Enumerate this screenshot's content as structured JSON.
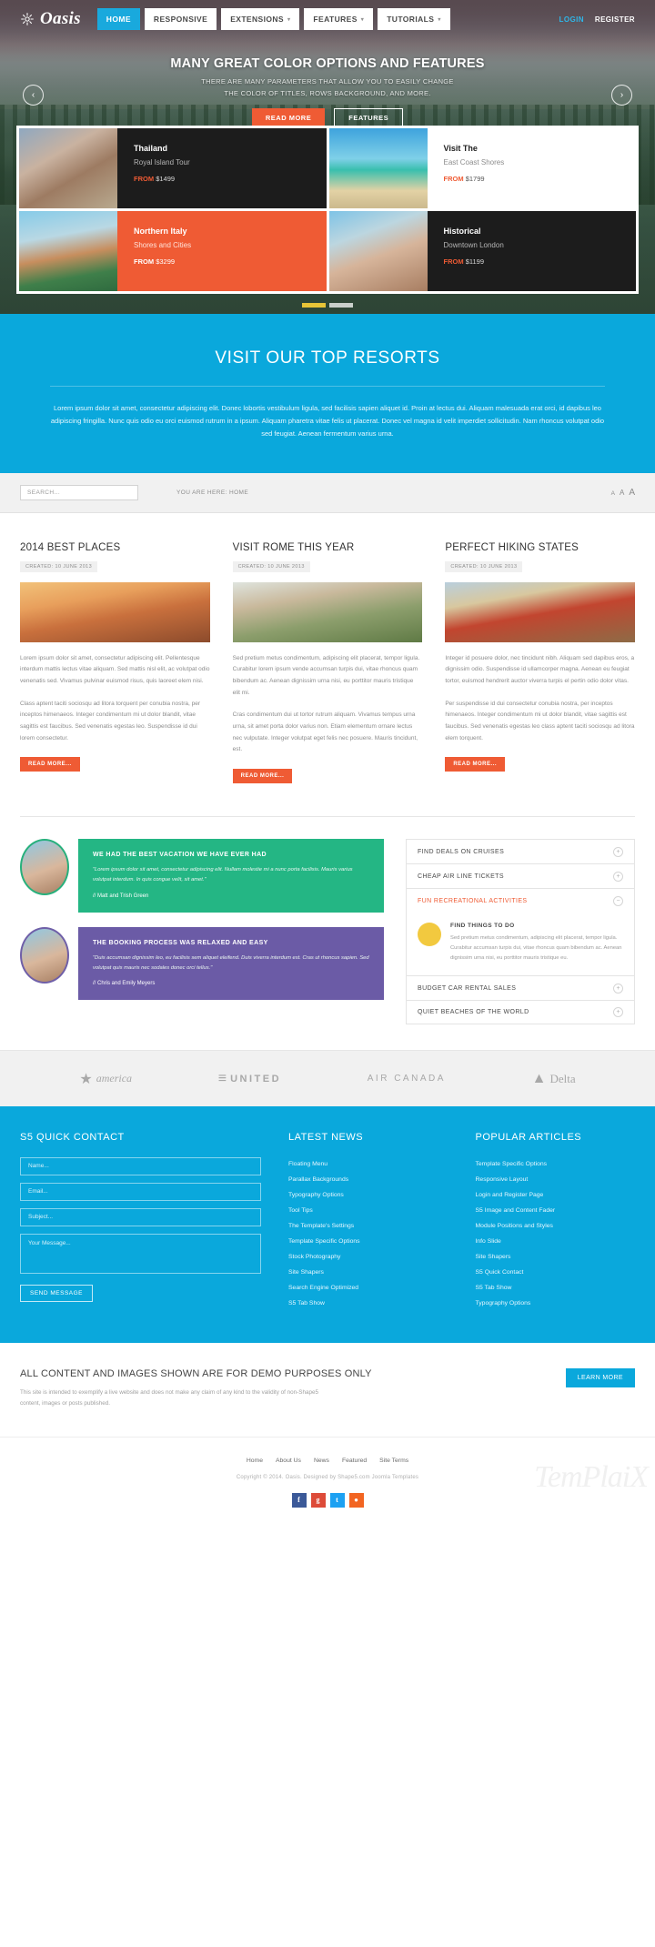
{
  "header": {
    "logo_text": "Oasis",
    "logo_icon": "gear-icon",
    "nav": [
      {
        "label": "HOME",
        "has_caret": false
      },
      {
        "label": "RESPONSIVE",
        "has_caret": false
      },
      {
        "label": "EXTENSIONS",
        "has_caret": true
      },
      {
        "label": "FEATURES",
        "has_caret": true
      },
      {
        "label": "TUTORIALS",
        "has_caret": true
      }
    ],
    "login": "LOGIN",
    "register": "REGISTER"
  },
  "hero": {
    "title": "MANY GREAT COLOR OPTIONS AND FEATURES",
    "sub1": "THERE ARE MANY PARAMETERS THAT ALLOW YOU TO EASILY CHANGE",
    "sub2": "THE COLOR OF TITLES, ROWS BACKGROUND, AND MORE.",
    "btn_primary": "READ MORE",
    "btn_secondary": "FEATURES",
    "arrow_prev": "‹",
    "arrow_next": "›"
  },
  "cards": [
    {
      "title": "Thailand",
      "sub": "Royal Island Tour",
      "from": "FROM",
      "price": "$1499",
      "style": "dark",
      "img": "img-bike"
    },
    {
      "title": "Visit The",
      "sub": "East Coast Shores",
      "from": "FROM",
      "price": "$1799",
      "style": "light",
      "img": "img-beach"
    },
    {
      "title": "Northern Italy",
      "sub": "Shores and Cities",
      "from": "FROM",
      "price": "$3299",
      "style": "orange",
      "img": "img-italy"
    },
    {
      "title": "Historical",
      "sub": "Downtown London",
      "from": "FROM",
      "price": "$1199",
      "style": "dark",
      "img": "img-couple"
    }
  ],
  "resorts": {
    "title": "VISIT OUR TOP RESORTS",
    "body": "Lorem ipsum dolor sit amet, consectetur adipiscing elit. Donec lobortis vestibulum ligula, sed facilisis sapien aliquet id. Proin at lectus dui. Aliquam malesuada erat orci, id dapibus leo adipiscing fringilla. Nunc quis odio eu orci euismod rutrum in a ipsum. Aliquam pharetra vitae felis ut placerat. Donec vel magna id velit imperdiet sollicitudin. Nam rhoncus volutpat odio sed feugiat. Aenean fermentum varius urna."
  },
  "searchbar": {
    "placeholder": "SEARCH...",
    "breadcrumb": "YOU ARE HERE:  HOME",
    "font_small": "A",
    "font_medium": "A",
    "font_large": "A"
  },
  "articles": [
    {
      "title": "2014 BEST PLACES",
      "meta": "CREATED: 10 JUNE 2013",
      "img": "ai1",
      "p1": "Lorem ipsum dolor sit amet, consectetur adipiscing elit. Pellentesque interdum mattis lectus vitae aliquam. Sed mattis nisl elit, ac volutpat odio venenatis sed. Vivamus pulvinar euismod risus, quis laoreet elem nisi.",
      "p2": "Class aptent taciti sociosqu ad litora torquent per conubia nostra, per inceptos himenaeos. Integer condimentum mi ut dolor blandit, vitae sagittis est faucibus. Sed venenatis egestas leo. Suspendisse id dui lorem consectetur.",
      "btn": "READ MORE..."
    },
    {
      "title": "VISIT ROME THIS YEAR",
      "meta": "CREATED: 10 JUNE 2013",
      "img": "ai2",
      "p1": "Sed pretium metus condimentum, adipiscing elit placerat, tempor ligula. Curabitur lorem ipsum vende accumsan turpis dui, vitae rhoncus quam bibendum ac. Aenean dignissim urna nisi, eu porttitor mauris tristique elit mi.",
      "p2": "Cras condimentum dui ut tortor rutrum aliquam. Vivamus tempus urna urna, sit amet porta dolor varius non. Etiam elementum ornare lectus nec vulputate. Integer volutpat eget felis nec posuere. Mauris tincidunt, est.",
      "btn": "READ MORE..."
    },
    {
      "title": "PERFECT HIKING STATES",
      "meta": "CREATED: 10 JUNE 2013",
      "img": "ai3",
      "p1": "Integer id posuere dolor, nec tincidunt nibh. Aliquam sed dapibus eros, a dignissim odio. Suspendisse id ullamcorper magna. Aenean eu feugiat tortor, euismod hendrerit auctor viverra turpis el pertin odio dolor vitas.",
      "p2": "Per suspendisse id dui consectetur conubia nostra, per inceptos himenaeos. Integer condimentum mi ut dolor blandit, vitae sagittis est faucibus. Sed venenatis egestas leo class aptent taciti sociosqu ad litora elem torquent.",
      "btn": "READ MORE..."
    }
  ],
  "testimonials": [
    {
      "heading": "WE HAD THE BEST VACATION WE HAVE EVER HAD",
      "quote": "\"Lorem ipsum dolor sit amet, consectetur adipiscing elit. Nullam molestie mi a nunc porta facilisis. Mauris varius volutpat interdum. In quis congue velit, sit amet.\"",
      "author": "// Matt and Trish Green",
      "color": "green"
    },
    {
      "heading": "THE BOOKING PROCESS WAS RELAXED AND EASY",
      "quote": "\"Duis accumsan dignissim leo, eu facilisis sem aliquet eleifend. Duis viverra interdum est. Cras ut rhoncus sapien. Sed volutpat quis mauris nec sodales donec orci tellus.\"",
      "author": "// Chris and Emily Meyers",
      "color": "purple"
    }
  ],
  "accordion": [
    {
      "label": "FIND DEALS ON CRUISES",
      "open": false,
      "sign": "+"
    },
    {
      "label": "CHEAP AIR LINE TICKETS",
      "open": false,
      "sign": "+"
    },
    {
      "label": "FUN RECREATIONAL ACTIVITIES",
      "open": true,
      "sign": "−"
    },
    {
      "label": "BUDGET CAR RENTAL SALES",
      "open": false,
      "sign": "+"
    },
    {
      "label": "QUIET BEACHES OF THE WORLD",
      "open": false,
      "sign": "+"
    }
  ],
  "accordion_panel": {
    "icon": "cloud-icon",
    "title": "FIND THINGS TO DO",
    "body": "Sed pretium metus condimentum, adipiscing elit placerat, tempor ligula. Curabitur accumsan turpis dui, vitae rhoncus quam bibendum ac. Aenean dignissim urna nisi, eu porttitor mauris tristique eu."
  },
  "brands": [
    {
      "name": "america",
      "style": "b1"
    },
    {
      "name": "UNITED",
      "style": "b2"
    },
    {
      "name": "AIR CANADA",
      "style": "b3"
    },
    {
      "name": "Delta",
      "style": "b4"
    }
  ],
  "footer": {
    "contact": {
      "heading": "S5 QUICK CONTACT",
      "name_placeholder": "Name...",
      "email_placeholder": "Email...",
      "subject_placeholder": "Subject...",
      "message_placeholder": "Your Message...",
      "send_label": "SEND MESSAGE"
    },
    "latest_news": {
      "heading": "LATEST NEWS",
      "items": [
        "Floating Menu",
        "Parallax Backgrounds",
        "Typography Options",
        "Tool Tips",
        "The Template's Settings",
        "Template Specific Options",
        "Stock Photography",
        "Site Shapers",
        "Search Engine Optimized",
        "S5 Tab Show"
      ]
    },
    "popular": {
      "heading": "POPULAR ARTICLES",
      "items": [
        "Template Specific Options",
        "Responsive Layout",
        "Login and Register Page",
        "S5 Image and Content Fader",
        "Module Positions and Styles",
        "Info Slide",
        "Site Shapers",
        "S5 Quick Contact",
        "S5 Tab Show",
        "Typography Options"
      ]
    }
  },
  "demo": {
    "title": "ALL CONTENT AND IMAGES SHOWN ARE FOR DEMO PURPOSES ONLY",
    "body": "This site is intended to exemplify a live website and does not make any claim of any kind to the validity of non-Shape5 content, images or posts published.",
    "button": "LEARN MORE"
  },
  "bottom": {
    "nav": [
      "Home",
      "About Us",
      "News",
      "Featured",
      "Site Terms"
    ],
    "copyright": "Copyright © 2014. Oasis. Designed by Shape5.com Joomla Templates",
    "socials": [
      {
        "name": "facebook-icon",
        "glyph": "f",
        "cls": "s-fb"
      },
      {
        "name": "google-plus-icon",
        "glyph": "g",
        "cls": "s-gp"
      },
      {
        "name": "twitter-icon",
        "glyph": "t",
        "cls": "s-tw"
      },
      {
        "name": "rss-icon",
        "glyph": "●",
        "cls": "s-rs"
      }
    ],
    "watermark": "TemPlaiX"
  }
}
